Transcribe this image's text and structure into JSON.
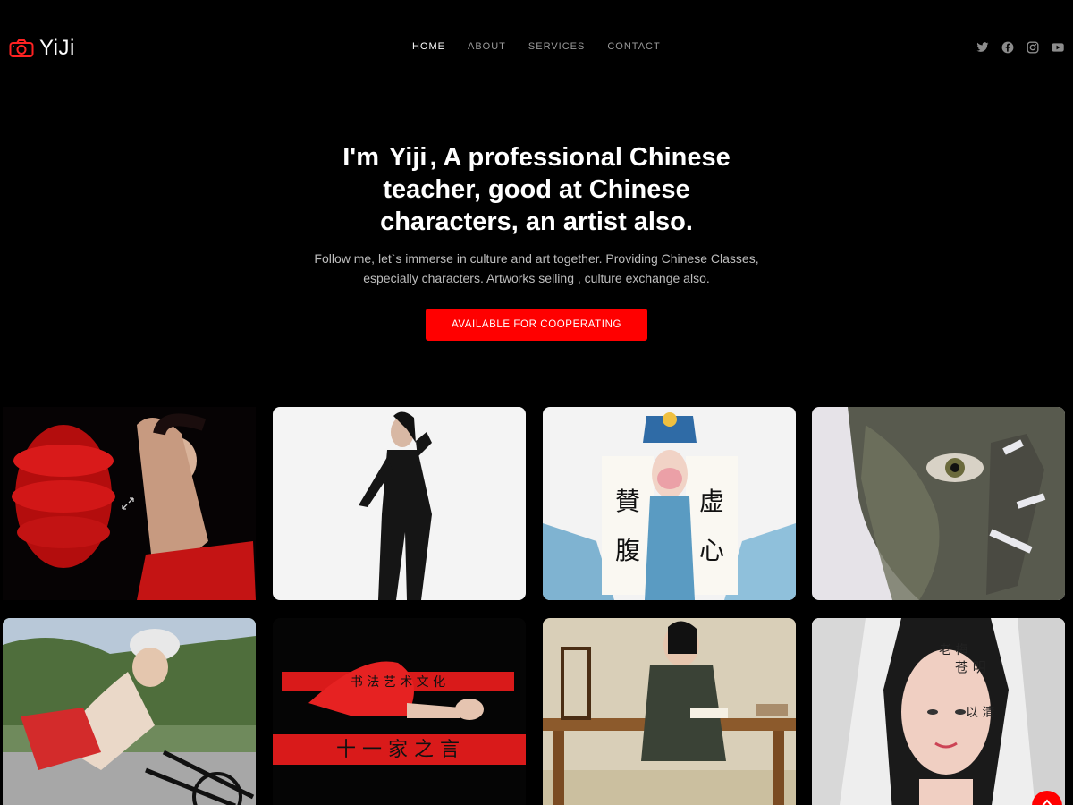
{
  "brand": {
    "name": "YiJi",
    "accent": "#ff0000"
  },
  "nav": {
    "items": [
      {
        "label": "HOME",
        "active": true
      },
      {
        "label": "ABOUT",
        "active": false
      },
      {
        "label": "SERVICES",
        "active": false
      },
      {
        "label": "CONTACT",
        "active": false
      }
    ]
  },
  "social": [
    "twitter-icon",
    "facebook-icon",
    "instagram-icon",
    "youtube-icon"
  ],
  "hero": {
    "title_prefix": "I'm ",
    "title_name": "Yiji",
    "title_suffix": ", A professional Chinese teacher, good at Chinese characters, an artist also.",
    "subtitle": "Follow me, let`s immerse in culture and art together. Providing Chinese Classes, especially characters. Artworks selling , culture exchange also.",
    "cta_label": "AVAILABLE FOR COOPERATING"
  },
  "gallery": {
    "tiles": [
      "red-lantern-dancer-photo",
      "black-bodysuit-pose-photo",
      "opera-calligraphy-scrolls-photo",
      "ink-painted-face-photo",
      "cyclist-calligraphy-photo",
      "red-dress-calligraphy-floor-photo",
      "writing-at-desk-photo",
      "calligraphy-face-selfie-photo"
    ]
  }
}
